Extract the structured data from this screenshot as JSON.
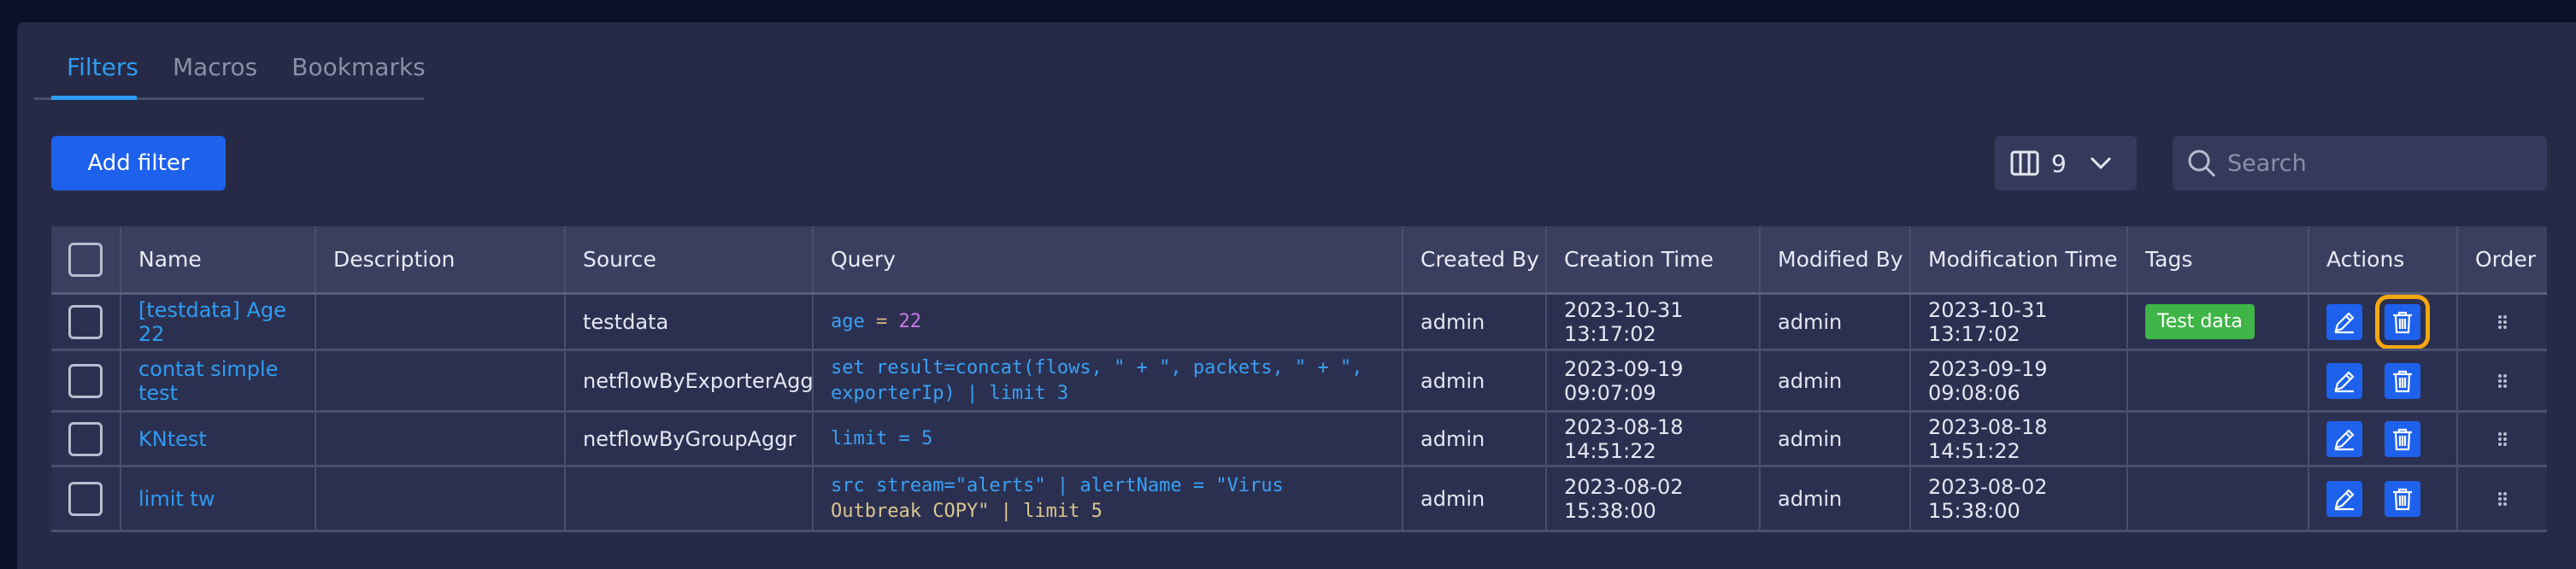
{
  "tabs": [
    {
      "label": "Filters",
      "active": true
    },
    {
      "label": "Macros",
      "active": false
    },
    {
      "label": "Bookmarks",
      "active": false
    }
  ],
  "toolbar": {
    "add_filter_label": "Add filter",
    "column_count": "9",
    "search_placeholder": "Search"
  },
  "table": {
    "headers": [
      "Name",
      "Description",
      "Source",
      "Query",
      "Created By",
      "Creation Time",
      "Modified By",
      "Modification Time",
      "Tags",
      "Actions",
      "Order"
    ],
    "rows": [
      {
        "name": "[testdata] Age 22",
        "description": "",
        "source": "testdata",
        "query": [
          [
            "age",
            "kw"
          ],
          [
            " = ",
            "op"
          ],
          [
            "22",
            "num"
          ]
        ],
        "created_by": "admin",
        "creation_time": "2023-10-31 13:17:02",
        "modified_by": "admin",
        "modification_time": "2023-10-31 13:17:02",
        "tag": "Test data"
      },
      {
        "name": "contat simple test",
        "description": "",
        "source": "netflowByExporterAggr",
        "query_line1": "set result=concat(flows, \" + \", packets, \" + \",",
        "query_line2": "exporterIp) | limit 3",
        "created_by": "admin",
        "creation_time": "2023-09-19 09:07:09",
        "modified_by": "admin",
        "modification_time_line1": "2023-09-19",
        "modification_time_line2": "09:08:06",
        "tag": ""
      },
      {
        "name": "KNtest",
        "description": "",
        "source": "netflowByGroupAggr",
        "query_line1": "limit = 5",
        "created_by": "admin",
        "creation_time": "2023-08-18 14:51:22",
        "modified_by": "admin",
        "modification_time": "2023-08-18 14:51:22",
        "tag": ""
      },
      {
        "name": "limit tw",
        "description": "",
        "source": "",
        "query_line1": "src stream=\"alerts\" | alertName = \"Virus",
        "query_line2": "Outbreak COPY\" | limit 5",
        "created_by": "admin",
        "creation_time_line1": "2023-08-02",
        "creation_time_line2": "15:38:00",
        "modified_by": "admin",
        "modification_time_line1": "2023-08-02",
        "modification_time_line2": "15:38:00",
        "tag": ""
      }
    ]
  },
  "colors": {
    "accent": "#1d61ec",
    "link": "#2e9cf2",
    "tag_green": "#3fb447",
    "highlight": "#f5a70f"
  },
  "icons": {
    "columns": "columns-icon",
    "chevron": "chevron-down-icon",
    "search": "search-icon",
    "edit": "pencil-icon",
    "delete": "trash-icon",
    "order": "drag-handle-icon"
  }
}
